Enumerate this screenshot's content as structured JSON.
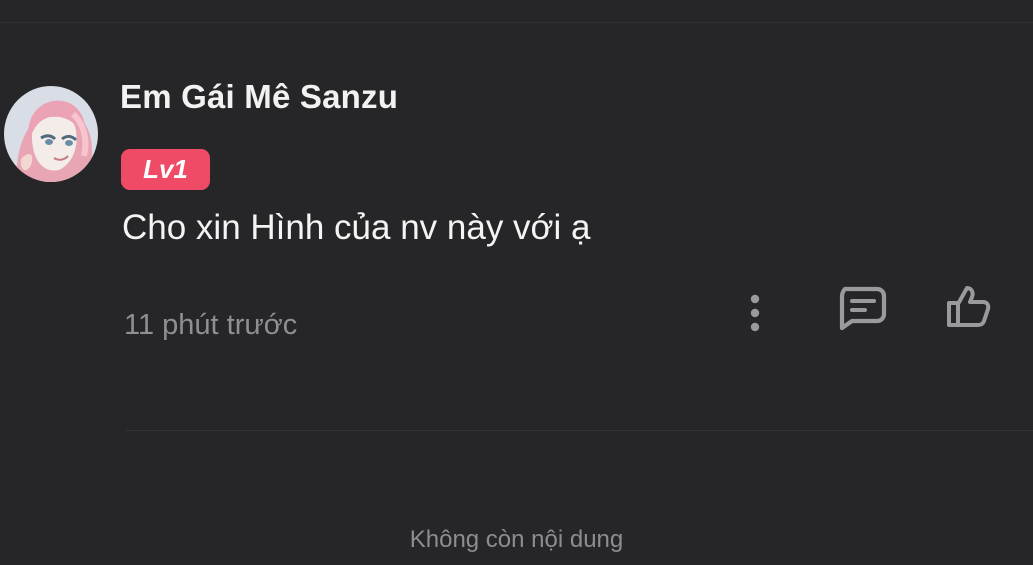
{
  "comment": {
    "username": "Em Gái Mê Sanzu",
    "level_badge": "Lv1",
    "text": "Cho xin Hình của nv này với ạ",
    "time_ago": "11 phút trước",
    "actions": {
      "more_icon": "vertical-dots-icon",
      "reply_icon": "comment-bubble-icon",
      "like_icon": "thumbs-up-icon"
    }
  },
  "footer": {
    "end_text": "Không còn nội dung"
  },
  "colors": {
    "background": "#262628",
    "badge": "#ef4b66",
    "muted_text": "#8f8f92",
    "icon": "#9a9a9e"
  }
}
